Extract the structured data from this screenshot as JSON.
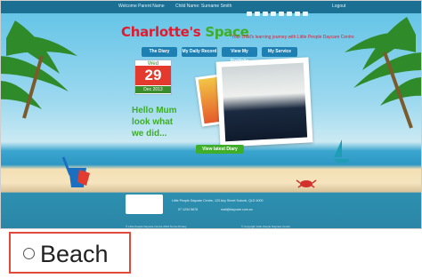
{
  "site": {
    "topbar": {
      "link1": "Welcome Parent Name",
      "link2": "Child Name: Surname Smith",
      "login": "Logout"
    },
    "logo": {
      "part1": "Charlotte's",
      "part2": "Space"
    },
    "tagline": "Your child's learning journey with Little People Daycare Centre",
    "nav": [
      "The Diary",
      "My Daily Record",
      "View My Portfolio",
      "My Service"
    ],
    "calendar": {
      "month": "Wed",
      "day": "29",
      "date": "Dec 2013"
    },
    "greeting": "Hello Mum\nlook what\nwe did...",
    "view_diary": "View latest Diary",
    "footer": {
      "address": "Little People Daycare Centre, 123 Any Street Suburb, QLD 4000",
      "phone": "07 1234 5678",
      "email": "mail@daycare.com.au",
      "small_left": "© Little People Daycare Centre 2013   Terms   Privacy",
      "small_right": "© Copyright Little People Daycare Centre"
    }
  },
  "answer": {
    "label": "Beach"
  },
  "colors": {
    "highlight": "#e04a3a",
    "logo_red": "#e5192d",
    "logo_green": "#3fae2a"
  }
}
